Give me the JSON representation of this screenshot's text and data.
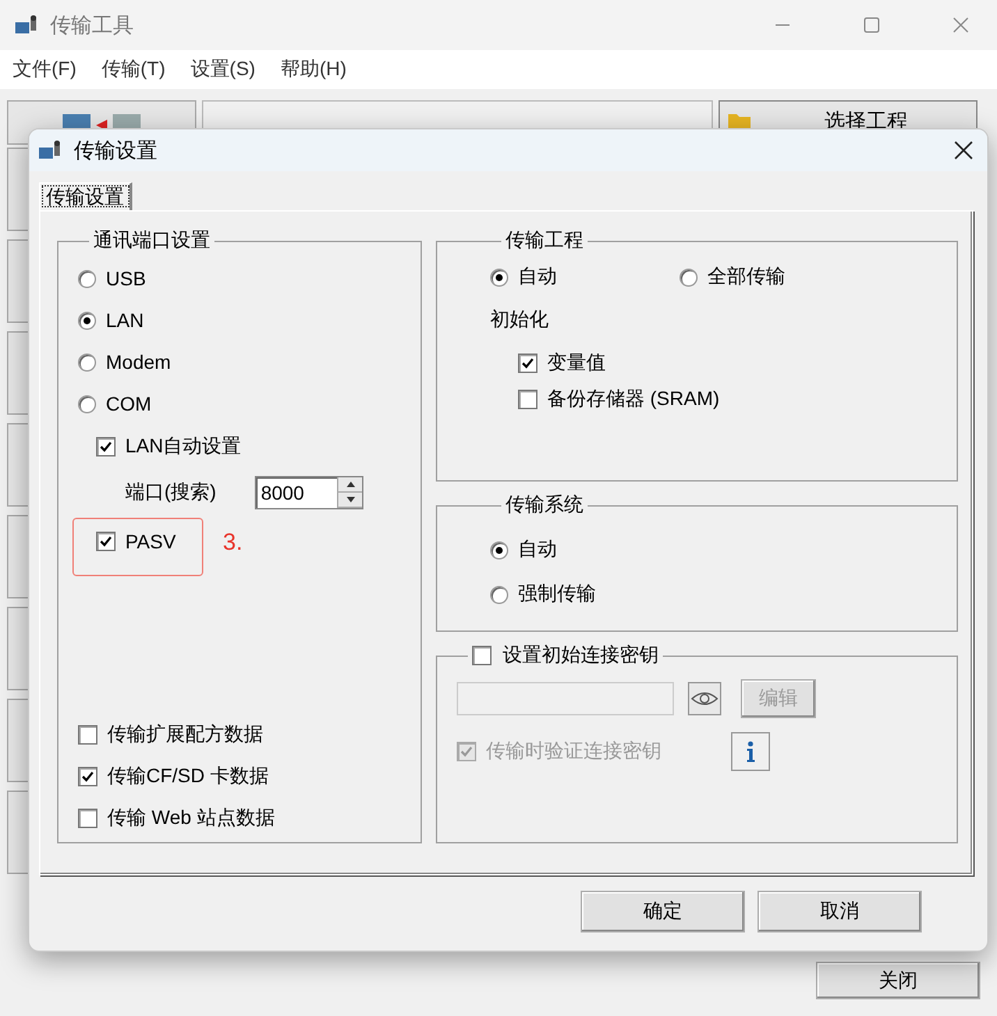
{
  "main_window": {
    "title": "传输工具",
    "menu": [
      "文件(F)",
      "传输(T)",
      "设置(S)",
      "帮助(H)"
    ],
    "select_project_button": "选择工程",
    "close_button": "关闭"
  },
  "dialog": {
    "title": "传输设置",
    "tabs": [
      {
        "label": "传输设置",
        "selected": true
      }
    ],
    "port_group": {
      "title": "通讯端口设置",
      "options": [
        {
          "label": "USB",
          "selected": false
        },
        {
          "label": "LAN",
          "selected": true
        },
        {
          "label": "Modem",
          "selected": false
        },
        {
          "label": "COM",
          "selected": false
        }
      ],
      "lan_auto": {
        "label": "LAN自动设置",
        "checked": true
      },
      "port": {
        "label": "端口(搜索)",
        "value": "8000"
      },
      "pasv": {
        "label": "PASV",
        "checked": true
      },
      "annotation": "3.",
      "extras": [
        {
          "label": "传输扩展配方数据",
          "checked": false
        },
        {
          "label": "传输CF/SD 卡数据",
          "checked": true
        },
        {
          "label": "传输 Web 站点数据",
          "checked": false
        }
      ]
    },
    "project_group": {
      "title": "传输工程",
      "options": [
        {
          "label": "自动",
          "selected": true
        },
        {
          "label": "全部传输",
          "selected": false
        }
      ],
      "init_label": "初始化",
      "init_items": [
        {
          "label": "变量值",
          "checked": true
        },
        {
          "label": "备份存储器 (SRAM)",
          "checked": false
        }
      ]
    },
    "system_group": {
      "title": "传输系统",
      "options": [
        {
          "label": "自动",
          "selected": true
        },
        {
          "label": "强制传输",
          "selected": false
        }
      ]
    },
    "key_group": {
      "label": "设置初始连接密钥",
      "checked": false,
      "edit_button": "编辑",
      "verify": {
        "label": "传输时验证连接密钥",
        "checked": true,
        "disabled": true
      }
    },
    "buttons": [
      "确定",
      "取消"
    ]
  }
}
